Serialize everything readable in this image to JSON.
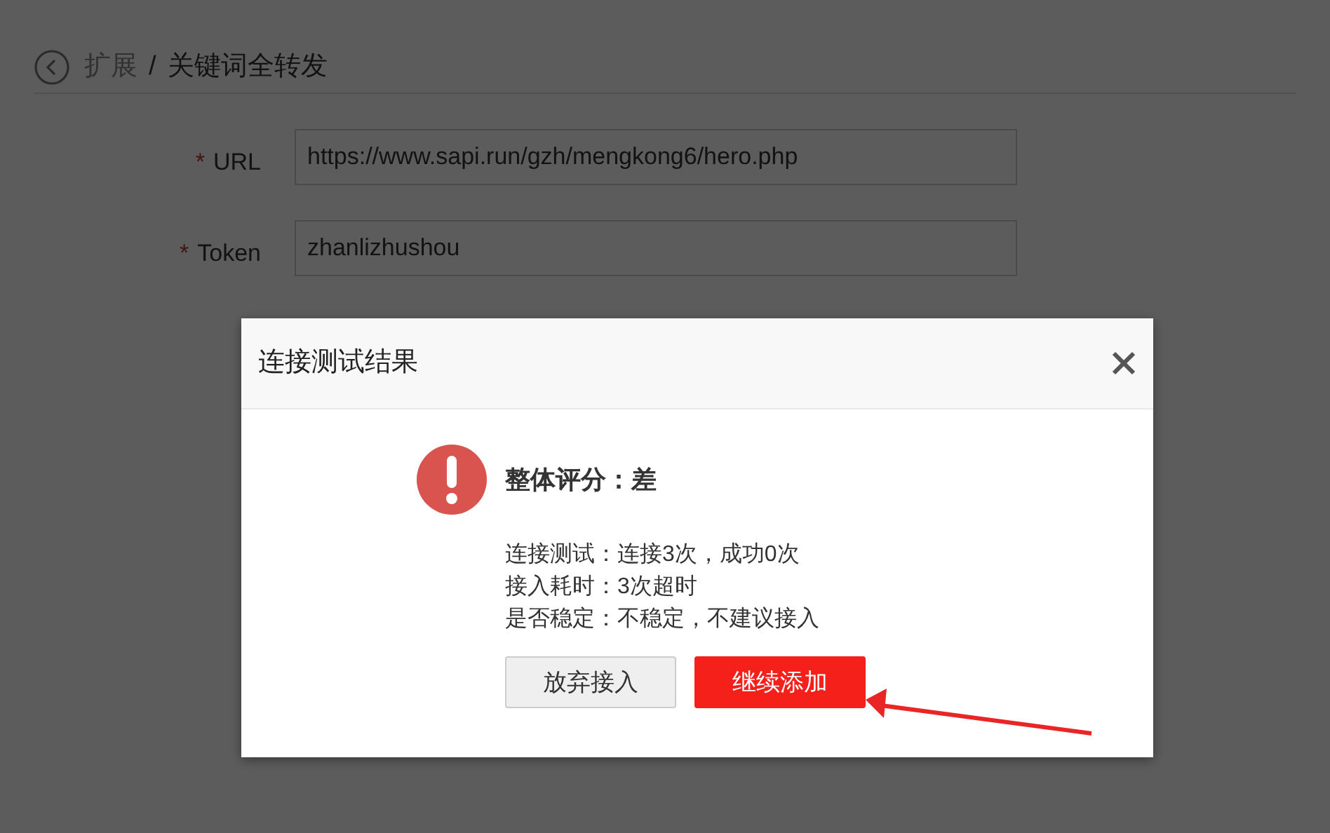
{
  "breadcrumb": {
    "parent": "扩展",
    "separator": "/",
    "current": "关键词全转发"
  },
  "form": {
    "fields": [
      {
        "required_mark": "*",
        "label": "URL",
        "value": "https://www.sapi.run/gzh/mengkong6/hero.php"
      },
      {
        "required_mark": "*",
        "label": "Token",
        "value": "zhanlizhushou"
      }
    ]
  },
  "dialog": {
    "title": "连接测试结果",
    "summary": "整体评分：差",
    "details": [
      "连接测试：连接3次，成功0次",
      "接入耗时：3次超时",
      "是否稳定：不稳定，不建议接入"
    ],
    "buttons": [
      {
        "label": "放弃接入",
        "kind": "secondary"
      },
      {
        "label": "继续添加",
        "kind": "primary"
      }
    ]
  }
}
